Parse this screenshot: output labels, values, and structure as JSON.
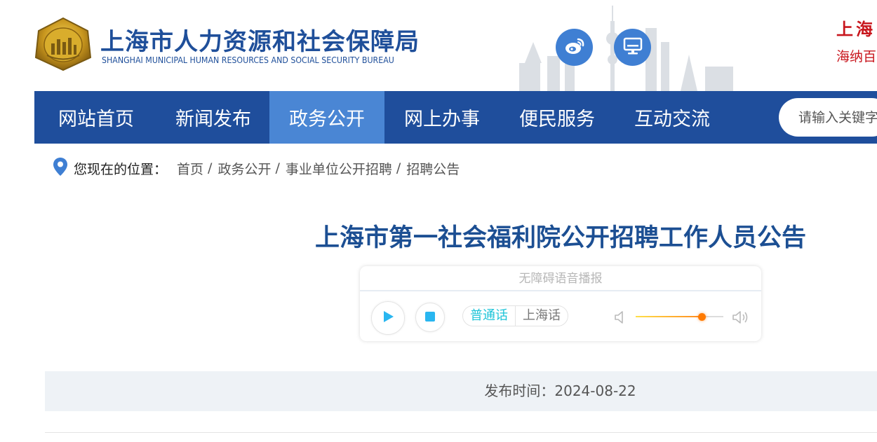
{
  "header": {
    "title_cn": "上海市人力资源和社会保障局",
    "title_en": "SHANGHAI MUNICIPAL HUMAN RESOURCES AND SOCIAL SECURITY BUREAU",
    "slogan_line1": "上海",
    "slogan_line2": "海纳百",
    "icons": [
      "weibo-icon",
      "computer-monitor-icon"
    ]
  },
  "nav": {
    "items": [
      {
        "label": "网站首页",
        "active": false
      },
      {
        "label": "新闻发布",
        "active": false
      },
      {
        "label": "政务公开",
        "active": true
      },
      {
        "label": "网上办事",
        "active": false
      },
      {
        "label": "便民服务",
        "active": false
      },
      {
        "label": "互动交流",
        "active": false
      }
    ],
    "search_placeholder": "请输入关键字"
  },
  "breadcrumb": {
    "label": "您现在的位置：",
    "items": [
      "首页",
      "政务公开",
      "事业单位公开招聘",
      "招聘公告"
    ],
    "separator": "/"
  },
  "article": {
    "title": "上海市第一社会福利院公开招聘工作人员公告",
    "publish_label": "发布时间：",
    "publish_date": "2024-08-22"
  },
  "player": {
    "header": "无障碍语音播报",
    "lang_mandarin": "普通话",
    "lang_shanghainese": "上海话",
    "volume_fraction": 0.75
  },
  "colors": {
    "nav_bg": "#1f4e9c",
    "nav_active": "#4a86d4",
    "title": "#1c4f93",
    "slogan": "#c8161d",
    "accent_cyan": "#1ec4d8",
    "icon_circle": "#3f7fd3"
  }
}
